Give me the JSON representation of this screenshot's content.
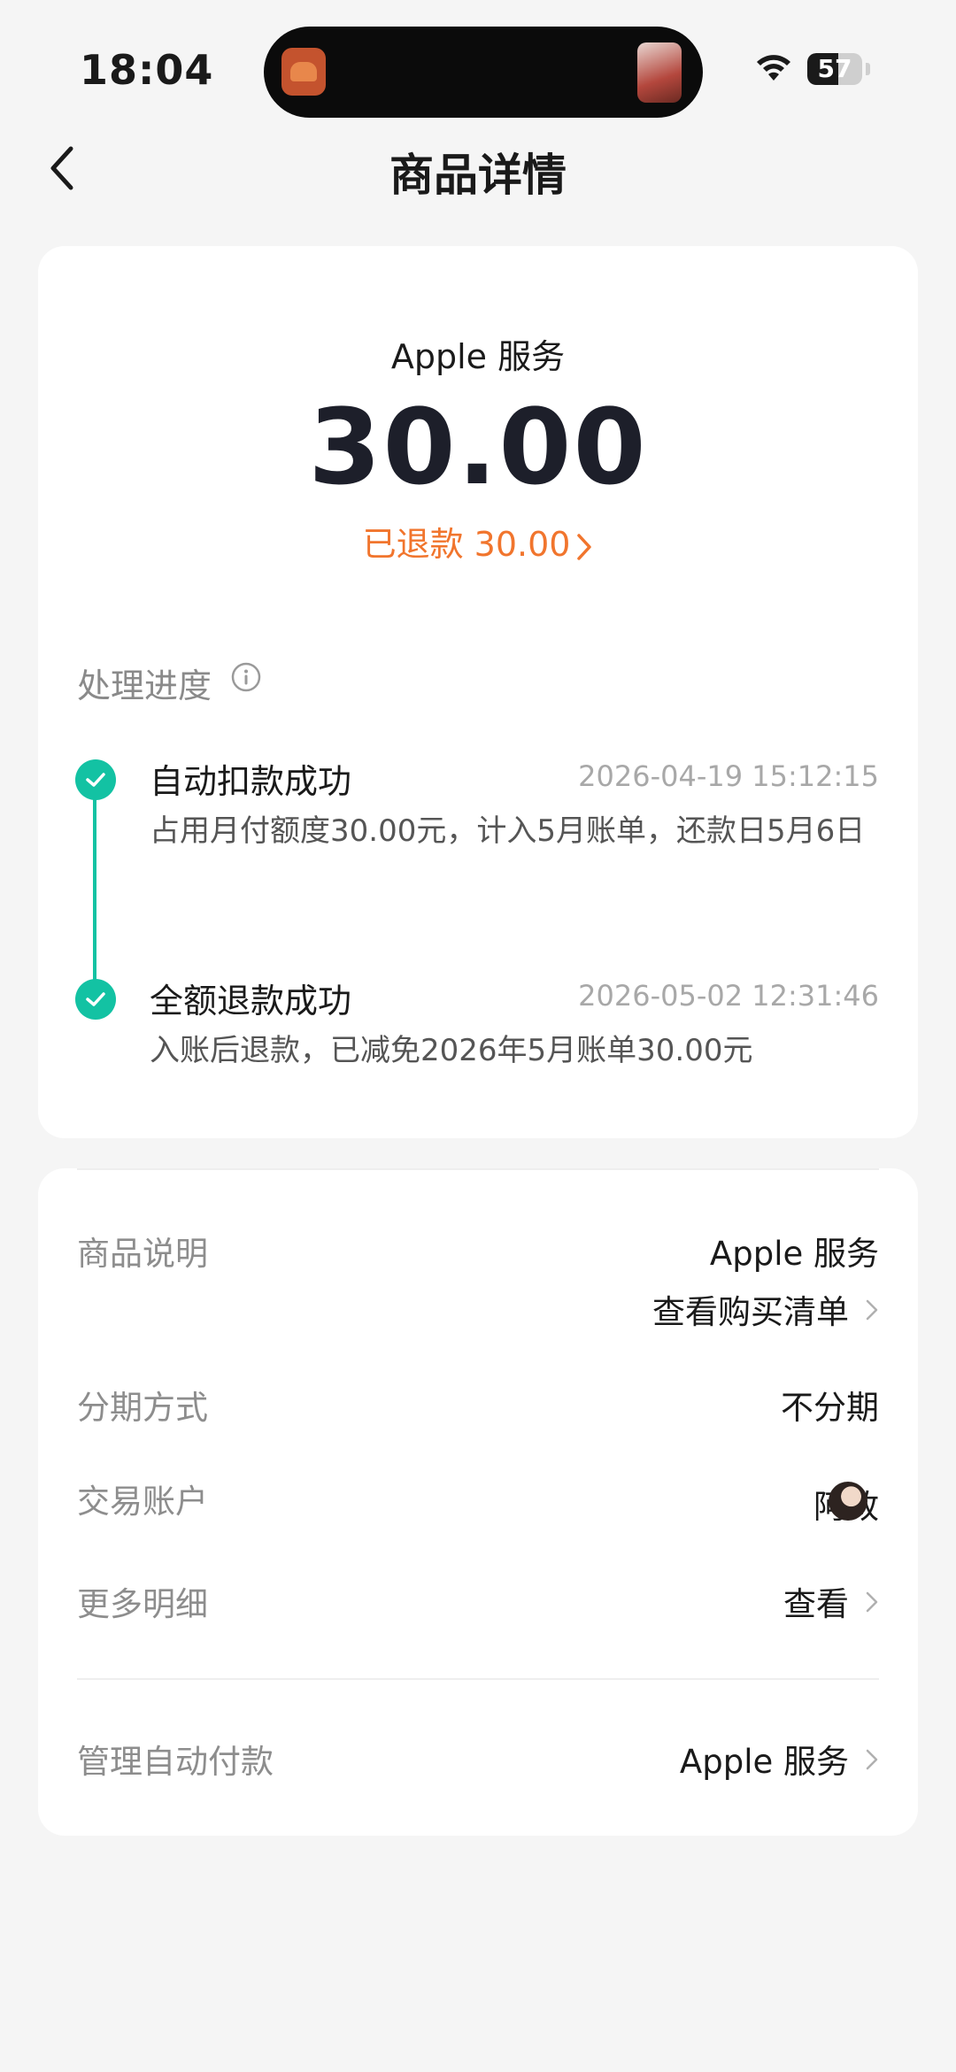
{
  "status_bar": {
    "time": "18:04",
    "battery_level": "57",
    "battery_fraction": 0.57
  },
  "nav": {
    "title": "商品详情"
  },
  "summary": {
    "merchant": "Apple 服务",
    "amount": "30.00",
    "refund_text": "已退款 30.00",
    "accent_color": "#f1752d"
  },
  "progress": {
    "title": "处理进度",
    "accent_color": "#13c2a3",
    "steps": [
      {
        "title": "自动扣款成功",
        "time": "2026-04-19 15:12:15",
        "desc": "占用月付额度30.00元，计入5月账单，还款日5月6日"
      },
      {
        "title": "全额退款成功",
        "time": "2026-05-02 12:31:46",
        "desc": "入账后退款，已减免2026年5月账单30.00元"
      }
    ]
  },
  "details": {
    "product_label": "商品说明",
    "product_value": "Apple 服务",
    "purchase_list_link": "查看购买清单",
    "installment_label": "分期方式",
    "installment_value": "不分期",
    "account_label": "交易账户",
    "account_value": "阿政",
    "more_label": "更多明细",
    "more_value": "查看",
    "autopay_label": "管理自动付款",
    "autopay_value": "Apple 服务"
  }
}
